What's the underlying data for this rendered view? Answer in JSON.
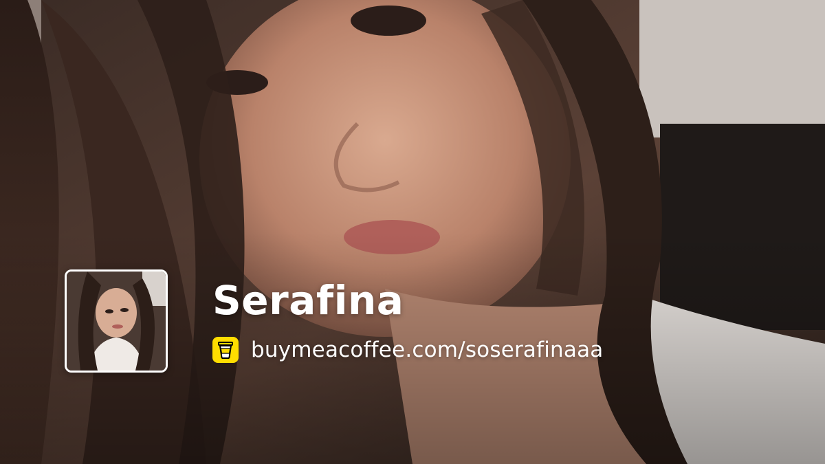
{
  "profile": {
    "name": "Serafina",
    "url": "buymeacoffee.com/soserafinaaa"
  },
  "icons": {
    "logo": "coffee-cup-icon"
  },
  "colors": {
    "logo_background": "#ffdd00",
    "text": "#ffffff"
  }
}
